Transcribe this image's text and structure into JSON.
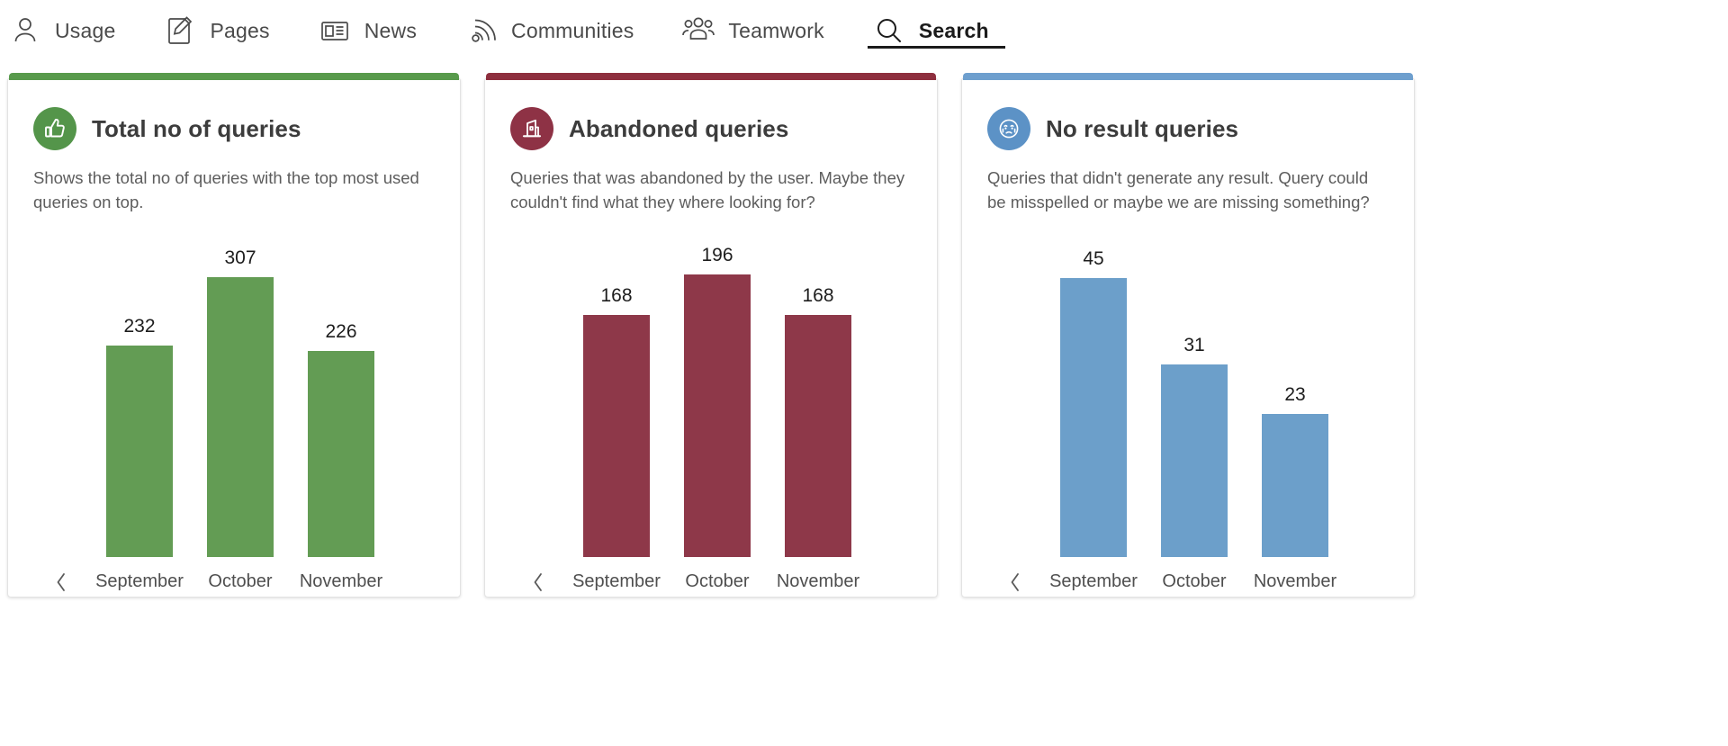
{
  "nav": {
    "items": [
      {
        "label": "Usage",
        "icon": "person-icon",
        "active": false
      },
      {
        "label": "Pages",
        "icon": "page-edit-icon",
        "active": false
      },
      {
        "label": "News",
        "icon": "newspaper-icon",
        "active": false
      },
      {
        "label": "Communities",
        "icon": "broadcast-icon",
        "active": false
      },
      {
        "label": "Teamwork",
        "icon": "people-group-icon",
        "active": false
      },
      {
        "label": "Search",
        "icon": "search-icon",
        "active": true
      }
    ]
  },
  "cards": [
    {
      "id": "total-no-of-queries",
      "title": "Total no of queries",
      "description": "Shows the total no of queries with the top most used queries on top.",
      "icon": "thumbs-up-icon",
      "accent_color": "#589A4C",
      "badge_color": "#54954A",
      "bar_color": "#639C54",
      "prev_label": "‹",
      "chart_data": {
        "type": "bar",
        "title": "Total no of queries",
        "categories": [
          "September",
          "October",
          "November"
        ],
        "values": [
          232,
          307,
          226
        ],
        "xlabel": "",
        "ylabel": "",
        "ylim": [
          0,
          340
        ],
        "grid": false,
        "legend": "none",
        "data_labels": true
      }
    },
    {
      "id": "abandoned-queries",
      "title": "Abandoned queries",
      "description": "Queries that was abandoned by the user. Maybe they couldn't find what they where looking for?",
      "icon": "bar-chart-building-icon",
      "accent_color": "#8E2F3E",
      "badge_color": "#8E3245",
      "bar_color": "#8E3849",
      "prev_label": "‹",
      "chart_data": {
        "type": "bar",
        "title": "Abandoned queries",
        "categories": [
          "September",
          "October",
          "November"
        ],
        "values": [
          168,
          196,
          168
        ],
        "xlabel": "",
        "ylabel": "",
        "ylim": [
          0,
          215
        ],
        "grid": false,
        "legend": "none",
        "data_labels": true
      }
    },
    {
      "id": "no-result-queries",
      "title": "No result queries",
      "description": "Queries that didn't generate any result. Query could be misspelled or maybe we are missing something?",
      "icon": "crying-face-icon",
      "accent_color": "#6E9FCE",
      "badge_color": "#5C92C6",
      "bar_color": "#6C9FCA",
      "prev_label": "‹",
      "chart_data": {
        "type": "bar",
        "title": "No result queries",
        "categories": [
          "September",
          "October",
          "November"
        ],
        "values": [
          45,
          31,
          23
        ],
        "xlabel": "",
        "ylabel": "",
        "ylim": [
          0,
          50
        ],
        "grid": false,
        "legend": "none",
        "data_labels": true
      }
    }
  ]
}
